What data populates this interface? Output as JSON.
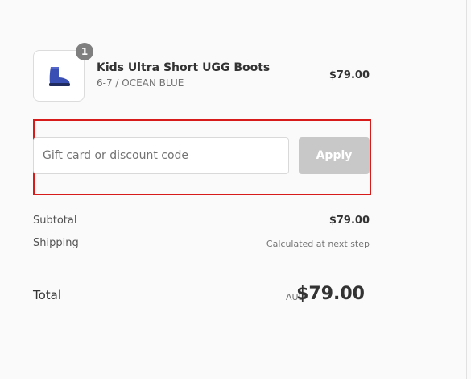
{
  "product": {
    "quantity": "1",
    "name": "Kids Ultra Short UGG Boots",
    "variant": "6-7 / OCEAN BLUE",
    "price": "$79.00",
    "image_icon": "boot-icon"
  },
  "discount": {
    "placeholder": "Gift card or discount code",
    "value": "",
    "apply_label": "Apply"
  },
  "summary": {
    "subtotal_label": "Subtotal",
    "subtotal_value": "$79.00",
    "shipping_label": "Shipping",
    "shipping_value": "Calculated at next step"
  },
  "total": {
    "label": "Total",
    "currency": "AUD",
    "amount": "$79.00"
  },
  "colors": {
    "highlight": "#d71a1a",
    "apply_disabled": "#c8c8c8",
    "boot": "#3a4fb4",
    "badge": "#7f7f7f"
  }
}
